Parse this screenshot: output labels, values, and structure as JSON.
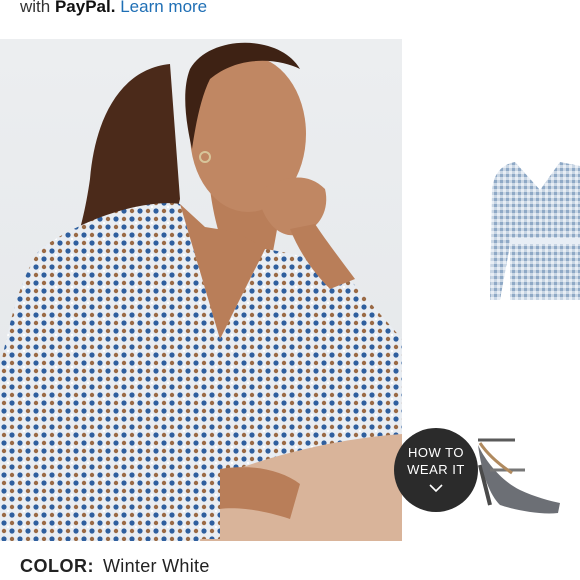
{
  "payment": {
    "prefix": "with",
    "brand": "PayPal.",
    "link_label": "Learn more"
  },
  "product_images": {
    "main_alt": "model wearing printed v-neck blouse",
    "thumb_icons": [
      "blouse-thumbnail-icon",
      "shoe-thumbnail-icon"
    ]
  },
  "how_to_wear": {
    "line1": "HOW TO",
    "line2": "WEAR IT"
  },
  "color": {
    "label": "COLOR:",
    "value": "Winter White"
  },
  "colors": {
    "link": "#1f6fb5",
    "badge_bg": "#2b2b2b",
    "print_blue": "#2f5f9e",
    "print_brown": "#9a6a45",
    "pants": "#d9b49a"
  }
}
